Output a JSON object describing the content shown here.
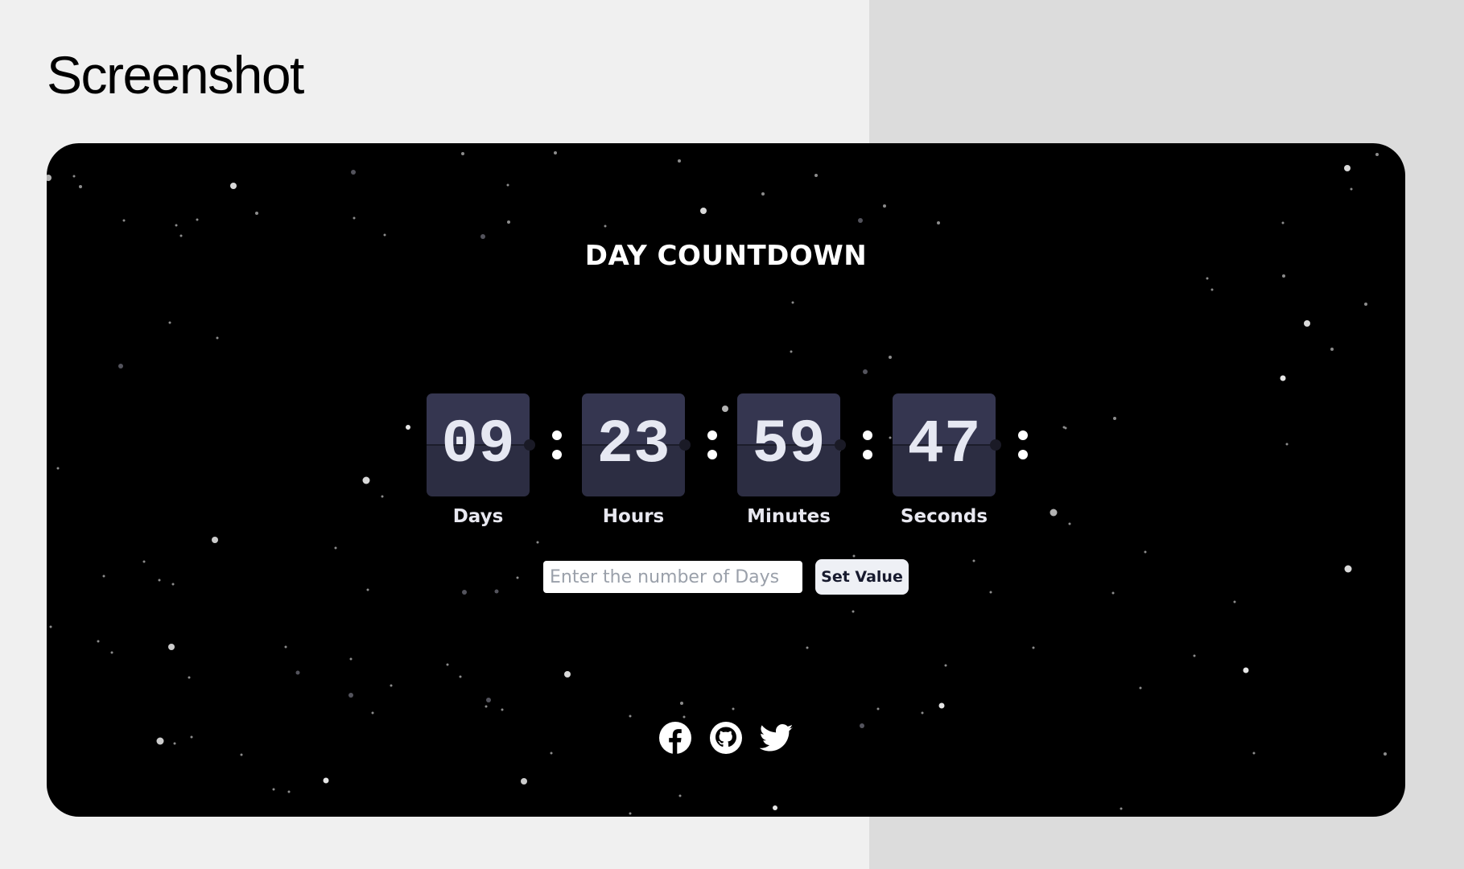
{
  "page": {
    "title": "Screenshot"
  },
  "app": {
    "heading": "DAY COUNTDOWN"
  },
  "countdown": [
    {
      "key": "days",
      "value": "09",
      "label": "Days"
    },
    {
      "key": "hours",
      "value": "23",
      "label": "Hours"
    },
    {
      "key": "minutes",
      "value": "59",
      "label": "Minutes"
    },
    {
      "key": "seconds",
      "value": "47",
      "label": "Seconds"
    }
  ],
  "separator": ":",
  "days_input": {
    "value": "",
    "placeholder": "Enter the number of Days"
  },
  "set_button": {
    "label": "Set Value"
  },
  "social_links": [
    {
      "name": "facebook",
      "icon": "facebook-icon"
    },
    {
      "name": "github",
      "icon": "github-icon"
    },
    {
      "name": "twitter",
      "icon": "twitter-icon"
    }
  ],
  "colors": {
    "card_background": "#000000",
    "flip_top": "#353650",
    "flip_bottom": "#2c2d42",
    "digit": "#e6e8f2",
    "button_background": "#eef0f5",
    "button_text": "#171a2e"
  }
}
